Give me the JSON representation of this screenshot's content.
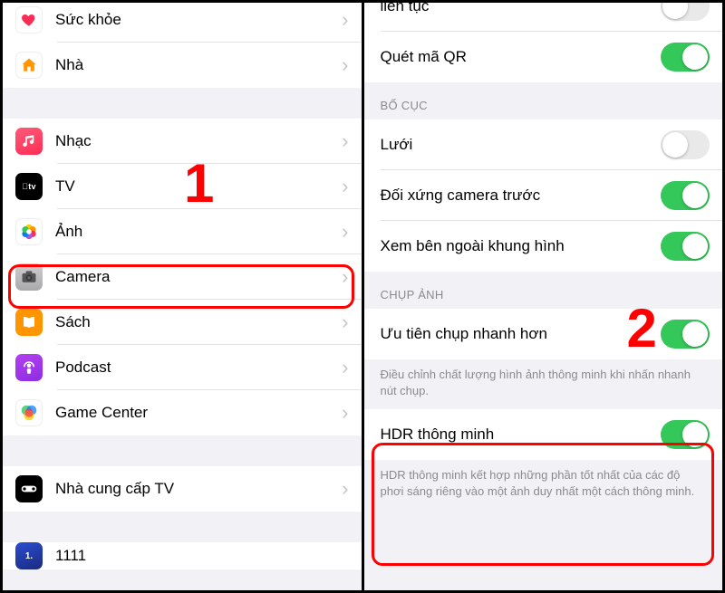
{
  "annotations": {
    "one": "1",
    "two": "2"
  },
  "left": {
    "items_top": [
      {
        "label": "Sức khỏe",
        "icon": "health"
      },
      {
        "label": "Nhà",
        "icon": "home"
      }
    ],
    "items_mid": [
      {
        "label": "Nhạc",
        "icon": "music"
      },
      {
        "label": "TV",
        "icon": "tv"
      },
      {
        "label": "Ảnh",
        "icon": "photos"
      },
      {
        "label": "Camera",
        "icon": "camera"
      },
      {
        "label": "Sách",
        "icon": "books"
      },
      {
        "label": "Podcast",
        "icon": "podcast"
      },
      {
        "label": "Game Center",
        "icon": "gamecenter"
      }
    ],
    "items_bot": [
      {
        "label": "Nhà cung cấp TV",
        "icon": "tvprovider"
      }
    ],
    "partial": {
      "label": "1111",
      "icon": "1111"
    }
  },
  "right": {
    "row_partial_top": {
      "label": "liên tục",
      "on": false
    },
    "row_qr": {
      "label": "Quét mã QR",
      "on": true
    },
    "section_layout": {
      "header": "BỐ CỤC",
      "grid": {
        "label": "Lưới",
        "on": false
      },
      "mirror": {
        "label": "Đối xứng camera trước",
        "on": true
      },
      "view": {
        "label": "Xem bên ngoài khung hình",
        "on": true
      }
    },
    "section_capture": {
      "header": "CHỤP ẢNH",
      "faster": {
        "label": "Ưu tiên chụp nhanh hơn",
        "on": true
      },
      "faster_footer": "Điều chỉnh chất lượng hình ảnh thông minh khi nhấn nhanh nút chụp.",
      "hdr": {
        "label": "HDR thông minh",
        "on": true
      },
      "hdr_footer": "HDR thông minh kết hợp những phần tốt nhất của các độ phơi sáng riêng vào một ảnh duy nhất một cách thông minh."
    }
  }
}
